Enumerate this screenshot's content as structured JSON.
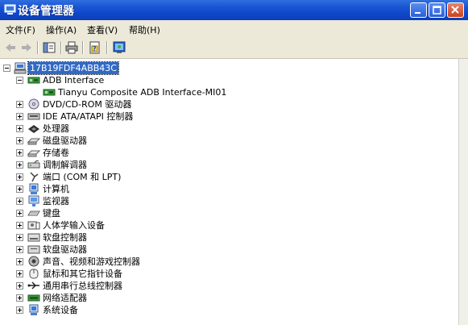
{
  "window": {
    "title": "设备管理器"
  },
  "menu": {
    "items": [
      "文件(F)",
      "操作(A)",
      "查看(V)",
      "帮助(H)"
    ]
  },
  "tree": {
    "root": "17B19FDF4ABB43C",
    "adb": {
      "label": "ADB Interface",
      "child": "Tianyu Composite ADB Interface-MI01"
    },
    "categories": [
      "DVD/CD-ROM 驱动器",
      "IDE ATA/ATAPI 控制器",
      "处理器",
      "磁盘驱动器",
      "存储卷",
      "调制解调器",
      "端口 (COM 和 LPT)",
      "计算机",
      "监视器",
      "键盘",
      "人体学输入设备",
      "软盘控制器",
      "软盘驱动器",
      "声音、视频和游戏控制器",
      "鼠标和其它指针设备",
      "通用串行总线控制器",
      "网络适配器",
      "系统设备"
    ]
  }
}
